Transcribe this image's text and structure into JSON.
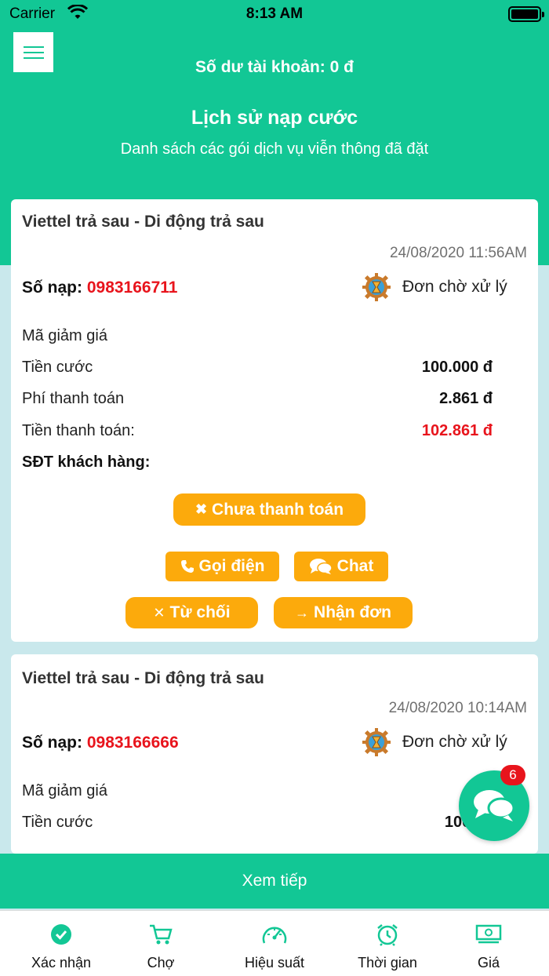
{
  "status_bar": {
    "carrier": "Carrier",
    "time": "8:13 AM"
  },
  "header": {
    "balance": "Số dư tài khoản: 0 đ",
    "title": "Lịch sử nạp cước",
    "subtitle": "Danh sách các gói dịch vụ viễn thông đã đặt"
  },
  "labels": {
    "so_nap": "Số nạp:",
    "discount": "Mã giảm giá",
    "fee": "Tiền cước",
    "payment_fee": "Phí thanh toán",
    "total": "Tiền thanh toán:",
    "customer_phone": "SĐT khách hàng:"
  },
  "orders": [
    {
      "service": "Viettel trả sau - Di động trả sau",
      "datetime": "24/08/2020 11:56AM",
      "phone": "0983166711",
      "status": "Đơn chờ xử lý",
      "fee": "100.000 đ",
      "payment_fee": "2.861 đ",
      "total": "102.861 đ",
      "payment_status": "Chưa thanh toán",
      "actions": {
        "call": "Gọi điện",
        "chat": "Chat",
        "reject": "Từ chối",
        "accept": "Nhận đơn"
      }
    },
    {
      "service": "Viettel trả sau - Di động trả sau",
      "datetime": "24/08/2020 10:14AM",
      "phone": "0983166666",
      "status": "Đơn chờ xử lý",
      "fee": "100.00"
    }
  ],
  "chat_badge": "6",
  "load_more": "Xem tiếp",
  "tabs": [
    {
      "label": "Xác nhận",
      "icon": "check-circle-icon"
    },
    {
      "label": "Chợ",
      "icon": "cart-icon"
    },
    {
      "label": "Hiệu suất",
      "icon": "speedometer-icon"
    },
    {
      "label": "Thời gian",
      "icon": "alarm-clock-icon"
    },
    {
      "label": "Giá",
      "icon": "money-icon"
    }
  ],
  "colors": {
    "primary": "#12c795",
    "accent": "#fcaa0c",
    "danger": "#e8141c",
    "background": "#c9e8ec"
  }
}
